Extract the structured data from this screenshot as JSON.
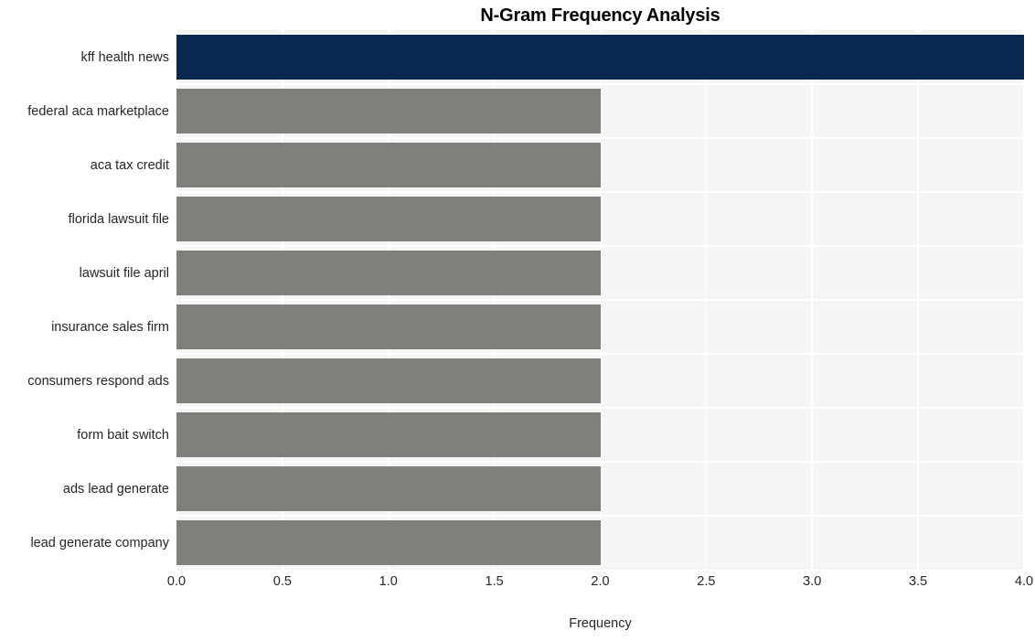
{
  "chart_data": {
    "type": "bar",
    "orientation": "horizontal",
    "title": "N-Gram Frequency Analysis",
    "xlabel": "Frequency",
    "ylabel": "",
    "categories": [
      "kff health news",
      "federal aca marketplace",
      "aca tax credit",
      "florida lawsuit file",
      "lawsuit file april",
      "insurance sales firm",
      "consumers respond ads",
      "form bait switch",
      "ads lead generate",
      "lead generate company"
    ],
    "values": [
      4,
      2,
      2,
      2,
      2,
      2,
      2,
      2,
      2,
      2
    ],
    "xlim": [
      0,
      4
    ],
    "xticks": [
      0,
      0.5,
      1,
      1.5,
      2,
      2.5,
      3,
      3.5,
      4
    ],
    "xtick_labels": [
      "0.0",
      "0.5",
      "1.0",
      "1.5",
      "2.0",
      "2.5",
      "3.0",
      "3.5",
      "4.0"
    ],
    "grid": true,
    "legend": null,
    "bar_colors": [
      "#0a2750",
      "#7f7f7c",
      "#7f7f7c",
      "#7f7f7c",
      "#7f7f7c",
      "#7f7f7c",
      "#7f7f7c",
      "#7f7f7c",
      "#7f7f7c",
      "#7f7f7c"
    ],
    "highlight_color": "#0a2750",
    "default_color": "#7f7f7c",
    "plot_background": "#f5f5f6",
    "figure_background": "#ffffff",
    "gridline_color": "#ffffff",
    "text_color": "#262626"
  }
}
